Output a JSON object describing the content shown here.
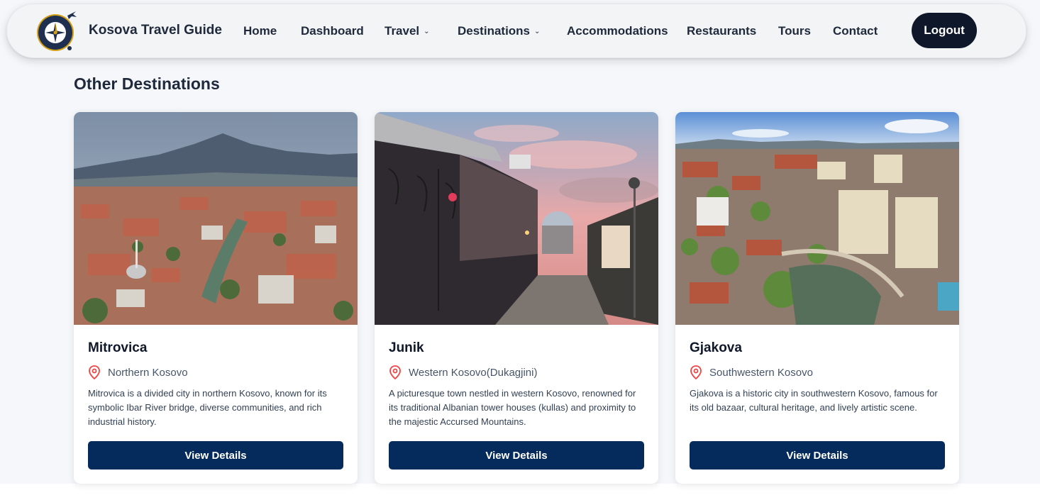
{
  "colors": {
    "nav_bg": "#f3f4f6",
    "logout_bg": "#0f172a",
    "button_bg": "#052b5c",
    "pin_color": "#ef4444",
    "page_bg": "#f5f7fb"
  },
  "nav": {
    "brand": "Kosova Travel Guide",
    "logo_icon": "compass-icon",
    "items": [
      {
        "label": "Home",
        "has_dropdown": false
      },
      {
        "label": "Dashboard",
        "has_dropdown": false
      },
      {
        "label": "Travel",
        "has_dropdown": true
      },
      {
        "label": "Destinations",
        "has_dropdown": true
      },
      {
        "label": "Accommodations",
        "has_dropdown": false
      },
      {
        "label": "Restaurants",
        "has_dropdown": false
      },
      {
        "label": "Tours",
        "has_dropdown": false
      },
      {
        "label": "Contact",
        "has_dropdown": false
      }
    ],
    "logout_label": "Logout"
  },
  "section": {
    "title": "Other Destinations"
  },
  "cards": [
    {
      "title": "Mitrovica",
      "location": "Northern Kosovo",
      "description": "Mitrovica is a divided city in northern Kosovo, known for its symbolic Ibar River bridge, diverse communities, and rich industrial history.",
      "button_label": "View Details",
      "location_icon": "map-pin-icon"
    },
    {
      "title": "Junik",
      "location": "Western Kosovo(Dukagjini)",
      "description": "A picturesque town nestled in western Kosovo, renowned for its traditional Albanian tower houses (kullas) and proximity to the majestic Accursed Mountains.",
      "button_label": "View Details",
      "location_icon": "map-pin-icon"
    },
    {
      "title": "Gjakova",
      "location": "Southwestern Kosovo",
      "description": "Gjakova is a historic city in southwestern Kosovo, famous for its old bazaar, cultural heritage, and lively artistic scene.",
      "button_label": "View Details",
      "location_icon": "map-pin-icon"
    }
  ]
}
